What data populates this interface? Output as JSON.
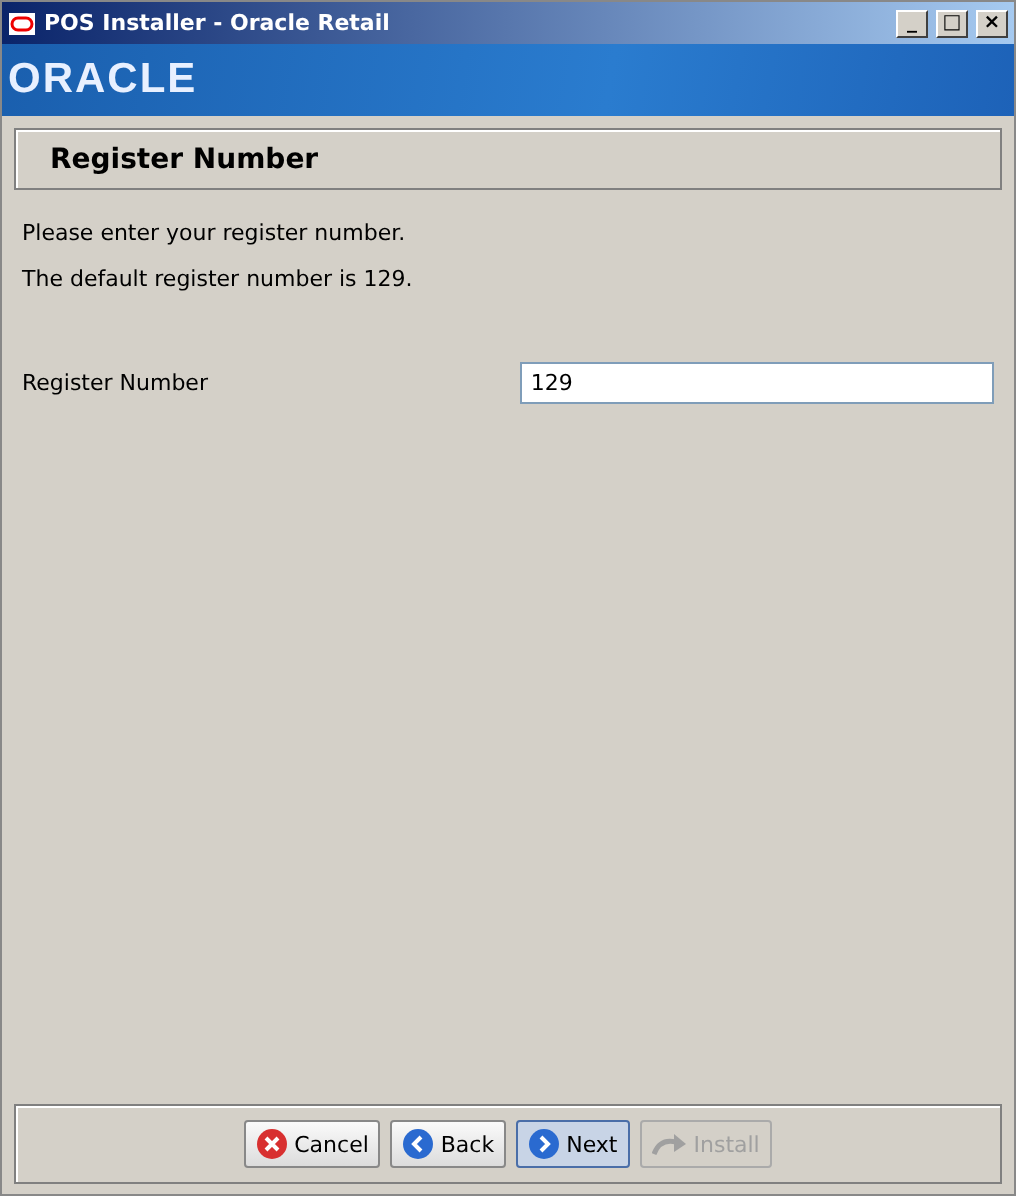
{
  "window": {
    "title": "POS Installer - Oracle Retail",
    "controls": [
      "_",
      "□",
      "×"
    ]
  },
  "banner": {
    "logo": "ORACLE"
  },
  "header": {
    "title": "Register Number"
  },
  "messages": [
    "Please enter your register number.",
    "The default register number is 129."
  ],
  "fields": [
    {
      "label": "Register Number",
      "value": "129"
    }
  ],
  "buttons": [
    {
      "kind": "cancel",
      "label": "Cancel",
      "disabled": false,
      "focused": false
    },
    {
      "kind": "back",
      "label": "Back",
      "disabled": false,
      "focused": false
    },
    {
      "kind": "next",
      "label": "Next",
      "disabled": false,
      "focused": true
    },
    {
      "kind": "install",
      "label": "Install",
      "disabled": true,
      "focused": false
    }
  ]
}
